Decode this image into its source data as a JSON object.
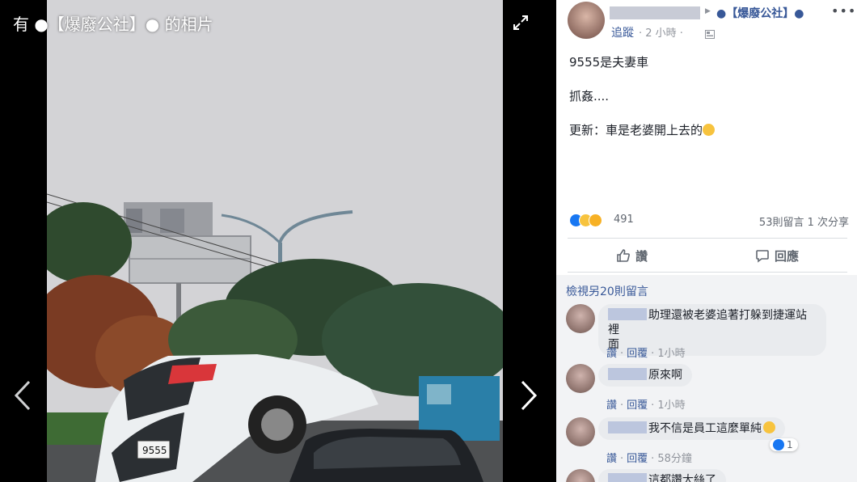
{
  "viewer": {
    "title": "有 ●【爆廢公社】● 的相片",
    "plate_text": "9555"
  },
  "post": {
    "page_name": "●【爆廢公社】●",
    "follow": "追蹤",
    "time": "· 2 小時 ·",
    "lines": [
      "9555是夫妻車",
      "抓姦....",
      "更新：車是老婆開上去的"
    ],
    "reaction_count": "491",
    "comments_shares": "53則留言  1 次分享",
    "like_label": "讚",
    "comment_label": "回應"
  },
  "comments": {
    "view_more": "檢視另20則留言",
    "items": [
      {
        "text_line1": "助理還被老婆追著打躲到捷運站裡",
        "text_line2": "面",
        "like": "讚",
        "reply": "回覆",
        "time": "1小時"
      },
      {
        "text_line1": "原來啊",
        "text_line2": "",
        "like": "讚",
        "reply": "回覆",
        "time": "1小時"
      },
      {
        "text_line1": "我不信是員工這麼單純",
        "text_line2": "",
        "like": "讚",
        "reply": "回覆",
        "time": "58分鐘",
        "reactions": "1"
      },
      {
        "text_line1": "這都讚大絲了",
        "text_line2": ""
      }
    ]
  },
  "colors": {
    "link": "#385898",
    "like_blue": "#1877f2",
    "panel_bg": "#ffffff",
    "comments_bg": "#f2f3f5"
  },
  "icons": [
    "expand-icon",
    "chevron-left-icon",
    "chevron-right-icon",
    "more-icon",
    "globe-icon",
    "like-icon",
    "comment-icon"
  ]
}
